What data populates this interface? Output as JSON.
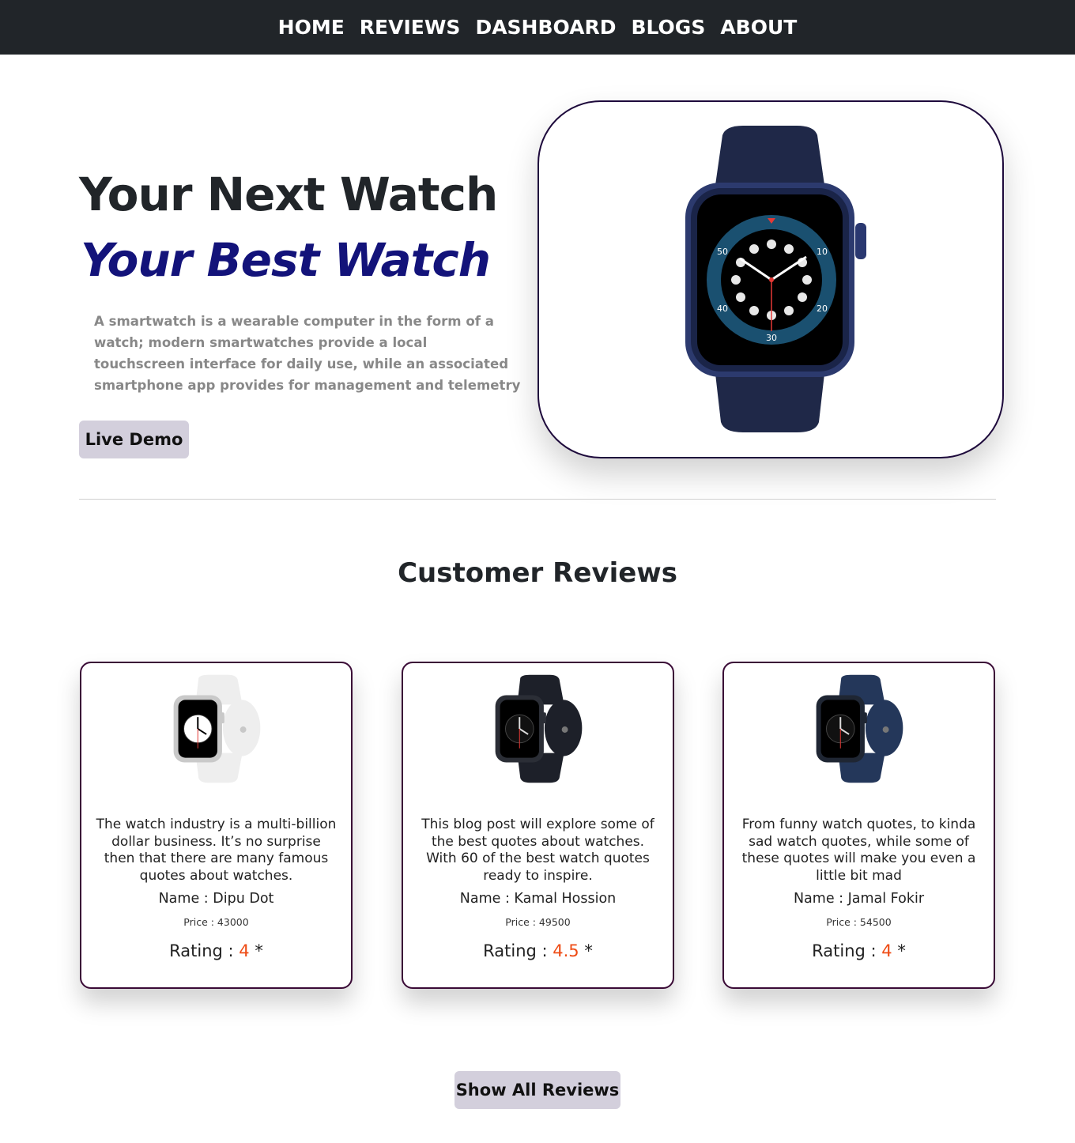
{
  "nav": {
    "items": [
      "HOME",
      "REVIEWS",
      "DASHBOARD",
      "BLOGS",
      "ABOUT"
    ]
  },
  "hero": {
    "title": "Your Next Watch",
    "subtitle": "Your Best Watch",
    "description": "A smartwatch is a wearable computer in the form of a watch; modern smartwatches provide a local touchscreen interface for daily use, while an associated smartphone app provides for management and telemetry",
    "button_label": "Live Demo",
    "image_icon": "smartwatch-navy-icon"
  },
  "reviews": {
    "title": "Customer Reviews",
    "rating_label": "Rating : ",
    "rating_suffix": " *",
    "items": [
      {
        "text": "The watch industry is a multi-billion dollar business. It’s no surprise then that there are many famous quotes about watches.",
        "name": "Name : Dipu Dot",
        "price": "Price : 43000",
        "rating": "4",
        "image_icon": "smartwatch-white-icon",
        "band_color": "#eeeeee",
        "case_color": "#c9c9c9"
      },
      {
        "text": "This blog post will explore some of the best quotes about watches. With 60 of the best watch quotes ready to inspire.",
        "name": "Name : Kamal Hossion",
        "price": "Price : 49500",
        "rating": "4.5",
        "image_icon": "smartwatch-black-icon",
        "band_color": "#1d2029",
        "case_color": "#2b2e36"
      },
      {
        "text": "From funny watch quotes, to kinda sad watch quotes, while some of these quotes will make you even a little bit mad",
        "name": "Name : Jamal Fokir",
        "price": "Price : 54500",
        "rating": "4",
        "image_icon": "smartwatch-blue-icon",
        "band_color": "#24375a",
        "case_color": "#1f2633"
      }
    ],
    "show_all_label": "Show All Reviews"
  },
  "colors": {
    "nav_bg": "#212529",
    "subtitle": "#13137a",
    "button_bg": "#d3cfdc",
    "card_border": "#3a0a36",
    "rating_value": "#ee4b14"
  }
}
